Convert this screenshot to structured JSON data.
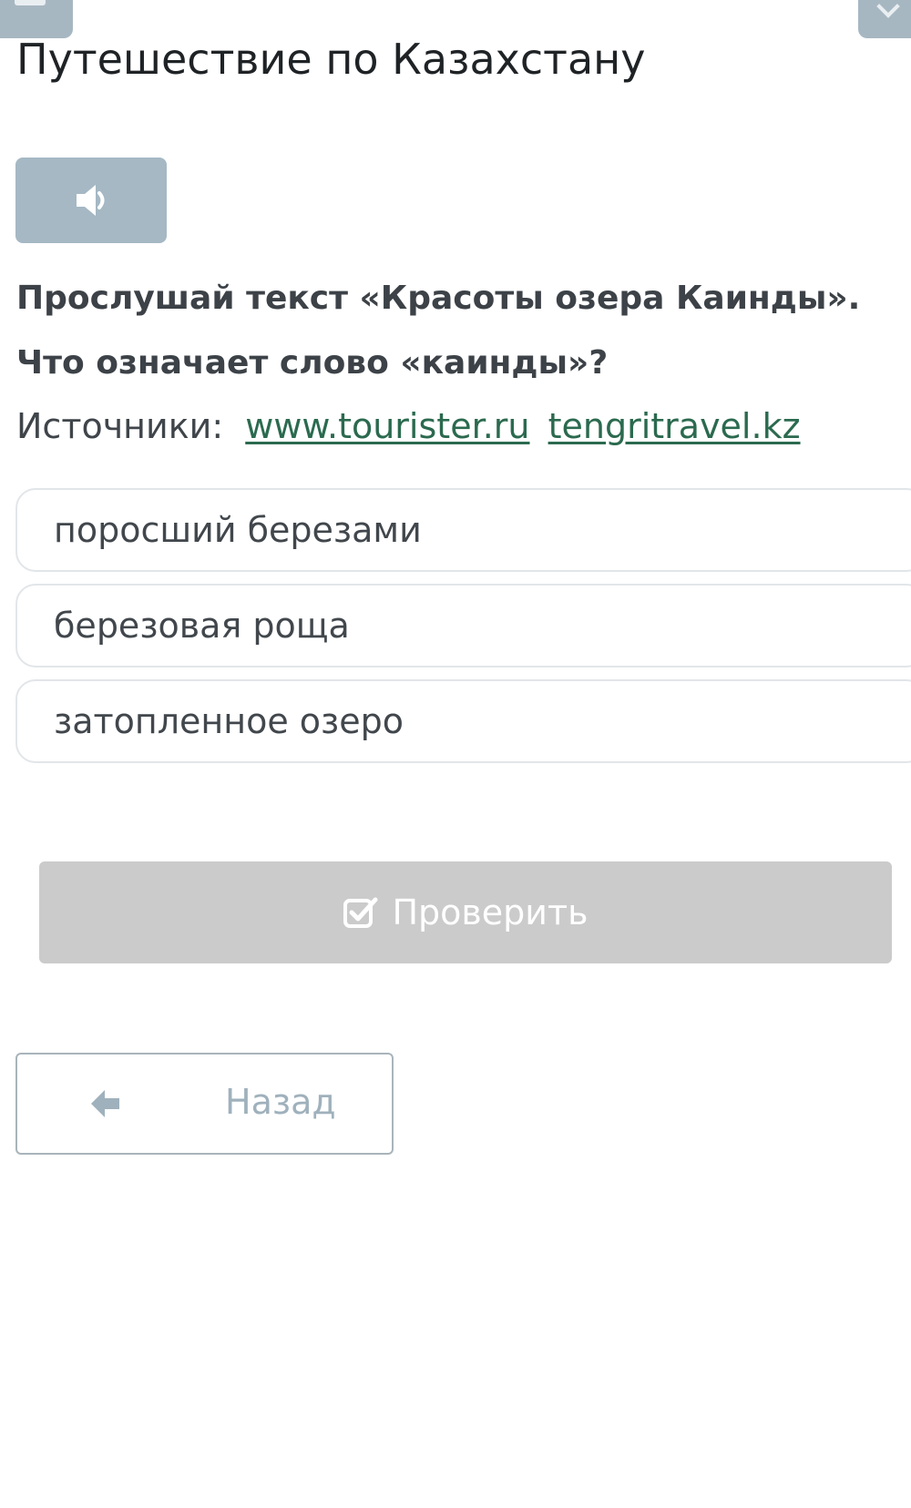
{
  "header": {
    "title": "Путешествие по Казахстану"
  },
  "audio": {
    "icon": "speaker-icon"
  },
  "question": {
    "line1": "Прослушай текст «Красоты озера Каинды».",
    "line2": "Что означает слово «каинды»?"
  },
  "sources": {
    "label": "Источники:",
    "links": [
      "www.tourister.ru",
      "tengritravel.kz"
    ]
  },
  "options": [
    "поросший березами",
    "березовая роща",
    "затопленное озеро"
  ],
  "actions": {
    "check_label": "Проверить",
    "check_icon": "check-square-icon",
    "back_label": "Назад",
    "back_icon": "arrow-left-icon"
  },
  "colors": {
    "audio_button": "#a5b8c4",
    "check_button_disabled": "#cbcbcb",
    "link": "#2b6a4f",
    "back_label": "#9fb1bc"
  }
}
